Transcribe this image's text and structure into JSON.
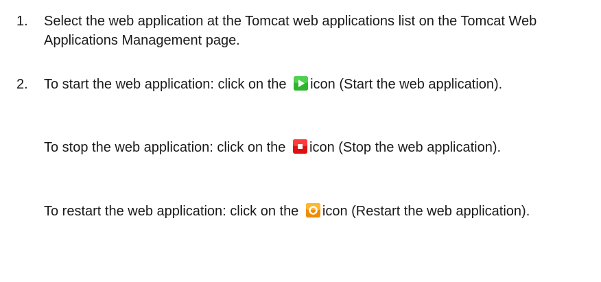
{
  "steps": [
    {
      "number": "1.",
      "text": "Select the web application at the Tomcat web applications list on the Tomcat Web Applications Management page."
    },
    {
      "number": "2.",
      "start": {
        "before": "To start the web application: click on the",
        "after": "icon (Start the web application).",
        "icon": "play-icon",
        "color": "#2db52d"
      },
      "stop": {
        "before": "To stop the web application: click on the",
        "after": "icon (Stop the web application).",
        "icon": "stop-icon",
        "color": "#ee1111"
      },
      "restart": {
        "before": "To restart the web application: click on the",
        "after": "icon (Restart the web application).",
        "icon": "restart-icon",
        "color": "#f29a00"
      }
    }
  ]
}
